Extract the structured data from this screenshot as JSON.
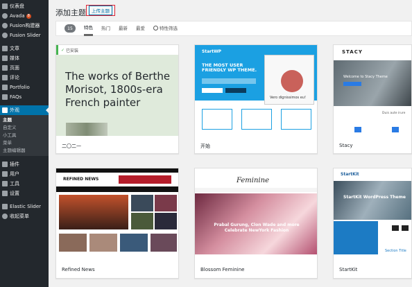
{
  "sidebar": {
    "items": [
      {
        "label": "仪表盘",
        "icon": "dashboard-icon"
      },
      {
        "label": "Avada",
        "icon": "avada-icon",
        "badge": "8"
      },
      {
        "label": "Fusion构建器",
        "icon": "fusion-builder-icon"
      },
      {
        "label": "Fusion Slider",
        "icon": "fusion-slider-icon"
      },
      {
        "label": "文章",
        "icon": "pin-icon"
      },
      {
        "label": "媒体",
        "icon": "media-icon"
      },
      {
        "label": "页面",
        "icon": "page-icon"
      },
      {
        "label": "评论",
        "icon": "comment-icon"
      },
      {
        "label": "Portfolio",
        "icon": "pin-icon"
      },
      {
        "label": "FAQs",
        "icon": "pin-icon"
      },
      {
        "label": "外观",
        "icon": "appearance-icon"
      }
    ],
    "submenu": [
      "主题",
      "自定义",
      "小工具",
      "菜单",
      "主题编辑器"
    ],
    "items2": [
      {
        "label": "插件",
        "icon": "plugin-icon"
      },
      {
        "label": "用户",
        "icon": "user-icon"
      },
      {
        "label": "工具",
        "icon": "tool-icon"
      },
      {
        "label": "设置",
        "icon": "settings-icon"
      },
      {
        "label": "Elastic Slider",
        "icon": "pin-icon"
      },
      {
        "label": "收起菜单",
        "icon": "collapse-icon"
      }
    ]
  },
  "header": {
    "title": "添加主题",
    "upload_label": "上传主题"
  },
  "filter": {
    "count": "15",
    "tabs": [
      "特色",
      "热门",
      "最新",
      "最爱"
    ],
    "feature_filter": "特性筛选"
  },
  "themes": [
    {
      "name": "二〇二一",
      "installed": "已安装",
      "preview_text": "The works of Berthe Morisot, 1800s-era French painter"
    },
    {
      "name": "开始",
      "hero_logo": "StartWP",
      "hero_text": "THE MOST USER FRIENDLY WP THEME.",
      "caption": "Vero dignissimos eu!"
    },
    {
      "name": "Stacy",
      "logo": "STACY",
      "welcome": "Welcome to Stacy Theme",
      "duis": "Duis aute irure"
    },
    {
      "name": "Refined News",
      "logo": "REFINED NEWS"
    },
    {
      "name": "Blossom Feminine",
      "logo": "Feminine",
      "hero_text": "Prabal Gurung, Clon Wade and more Celebrate NewYork Fashion"
    },
    {
      "name": "StartKit",
      "logo": "StartKit",
      "hero_title": "StartKit WordPress Theme",
      "section_title": "Section Title"
    }
  ],
  "colors": {
    "sidebar": "#23282d",
    "active": "#0073aa",
    "installed": "#46b450",
    "badge": "#d54e21"
  }
}
